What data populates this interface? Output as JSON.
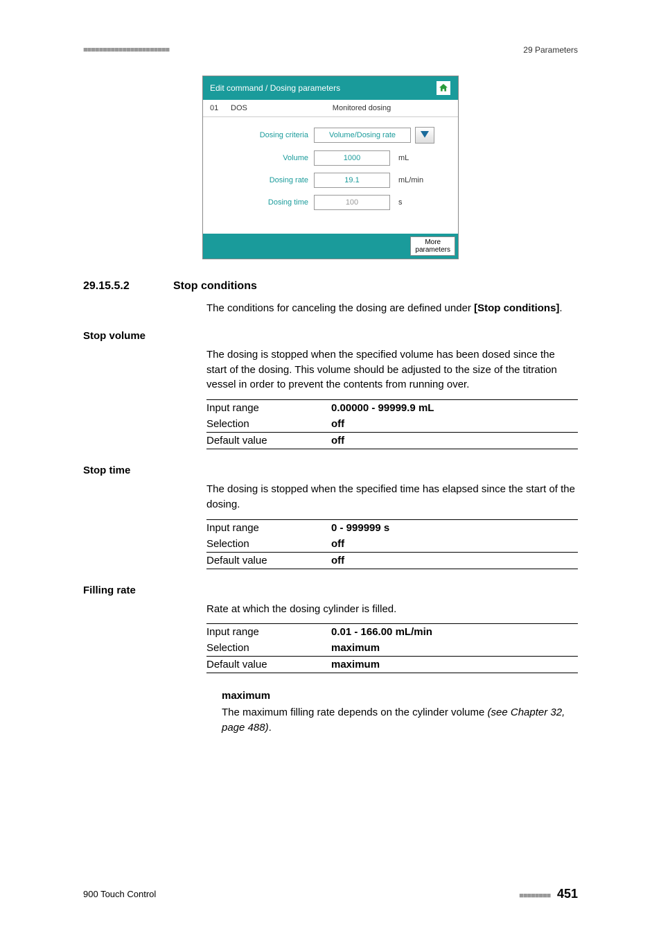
{
  "header": {
    "marks": "■■■■■■■■■■■■■■■■■■■■■■",
    "chapter": "29 Parameters"
  },
  "screenshot": {
    "title": "Edit command / Dosing parameters",
    "sub": {
      "num": "01",
      "cmd": "DOS",
      "mode": "Monitored dosing"
    },
    "rows": {
      "criteria": {
        "label": "Dosing criteria",
        "value": "Volume/Dosing rate"
      },
      "volume": {
        "label": "Volume",
        "value": "1000",
        "unit": "mL"
      },
      "rate": {
        "label": "Dosing rate",
        "value": "19.1",
        "unit": "mL/min"
      },
      "time": {
        "label": "Dosing time",
        "value": "100",
        "unit": "s"
      }
    },
    "footer_btn": "More\nparameters"
  },
  "section": {
    "num": "29.15.5.2",
    "title": "Stop conditions",
    "intro_pre": "The conditions for canceling the dosing are defined under ",
    "intro_bold": "[Stop conditions]",
    "intro_post": "."
  },
  "params": {
    "stop_volume": {
      "label": "Stop volume",
      "desc": "The dosing is stopped when the specified volume has been dosed since the start of the dosing. This volume should be adjusted to the size of the titration vessel in order to prevent the contents from running over.",
      "rows": {
        "input_range_label": "Input range",
        "input_range_value": "0.00000 - 99999.9 mL",
        "selection_label": "Selection",
        "selection_value": "off",
        "default_label": "Default value",
        "default_value": "off"
      }
    },
    "stop_time": {
      "label": "Stop time",
      "desc": "The dosing is stopped when the specified time has elapsed since the start of the dosing.",
      "rows": {
        "input_range_label": "Input range",
        "input_range_value": "0 - 999999 s",
        "selection_label": "Selection",
        "selection_value": "off",
        "default_label": "Default value",
        "default_value": "off"
      }
    },
    "filling_rate": {
      "label": "Filling rate",
      "desc": "Rate at which the dosing cylinder is filled.",
      "rows": {
        "input_range_label": "Input range",
        "input_range_value": "0.01 - 166.00 mL/min",
        "selection_label": "Selection",
        "selection_value": "maximum",
        "default_label": "Default value",
        "default_value": "maximum"
      },
      "sub": {
        "term": "maximum",
        "text_pre": "The maximum filling rate depends on the cylinder volume ",
        "ref": "(see Chapter 32, page 488)",
        "text_post": "."
      }
    }
  },
  "footer": {
    "product": "900 Touch Control",
    "marks": "■■■■■■■■",
    "page": "451"
  }
}
